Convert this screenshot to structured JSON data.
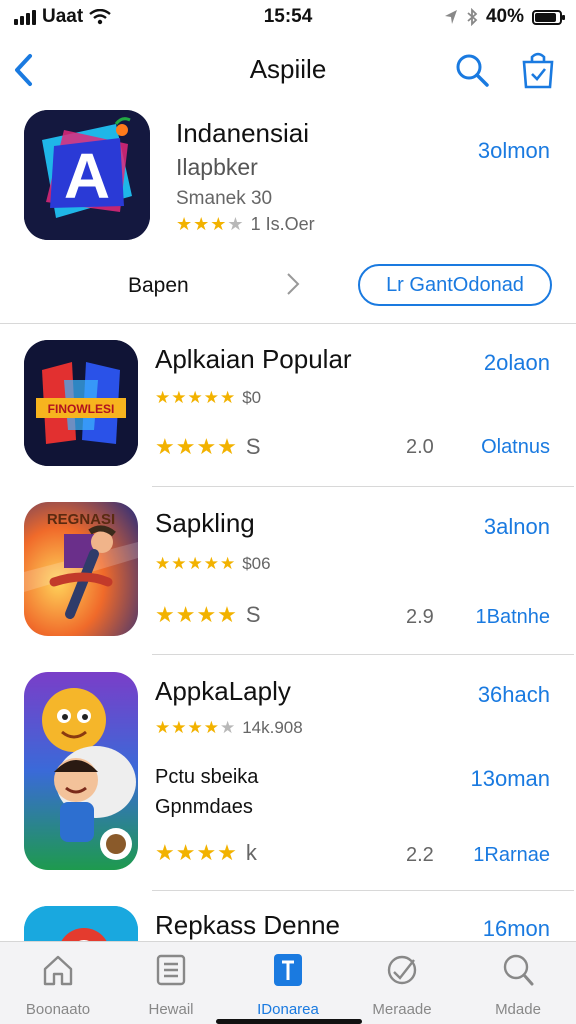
{
  "status": {
    "carrier": "Uaat",
    "time": "15:54",
    "battery": "40%",
    "battery_level": 0.8
  },
  "nav": {
    "title": "Aspiile"
  },
  "featured": {
    "name": "Indanensiai",
    "subtitle": "Ilapbker",
    "meta": "Smanek 30",
    "rating_text": "1 Is.Oer",
    "price": "3olmon",
    "open_label": "Bapen",
    "get_label": "Lr GantOdonad",
    "icon_letter": "A"
  },
  "apps": [
    {
      "name": "Aplkaian Popular",
      "price": "2olaon",
      "stars_text": "$0",
      "stars2_text": "S",
      "size": "2.0",
      "downloads": "Olatnus",
      "banner": "FINOWLESI"
    },
    {
      "name": "Sapkling",
      "price": "3alnon",
      "stars_text": "$06",
      "stars2_text": "S",
      "size": "2.9",
      "downloads": "1Batnhe",
      "banner": "REGNASI"
    },
    {
      "name": "AppkaLaply",
      "price": "36hach",
      "stars_text": "14k.908",
      "desc_line1": "Pctu sbeika",
      "desc_line2": "Gpnmdaes",
      "desc_price": "13oman",
      "stars2_text": "k",
      "size": "2.2",
      "downloads": "1Rarnae"
    },
    {
      "name": "Repkass Denne",
      "price": "16mon"
    }
  ],
  "tabs": [
    {
      "label": "Boonaato",
      "icon": "home-icon"
    },
    {
      "label": "Hewail",
      "icon": "list-icon"
    },
    {
      "label": "IDonarea",
      "icon": "apps-icon"
    },
    {
      "label": "Meraade",
      "icon": "satellite-icon"
    },
    {
      "label": "Mdade",
      "icon": "search-icon"
    }
  ],
  "colors": {
    "accent": "#1a7ae0",
    "star": "#f2b200"
  }
}
